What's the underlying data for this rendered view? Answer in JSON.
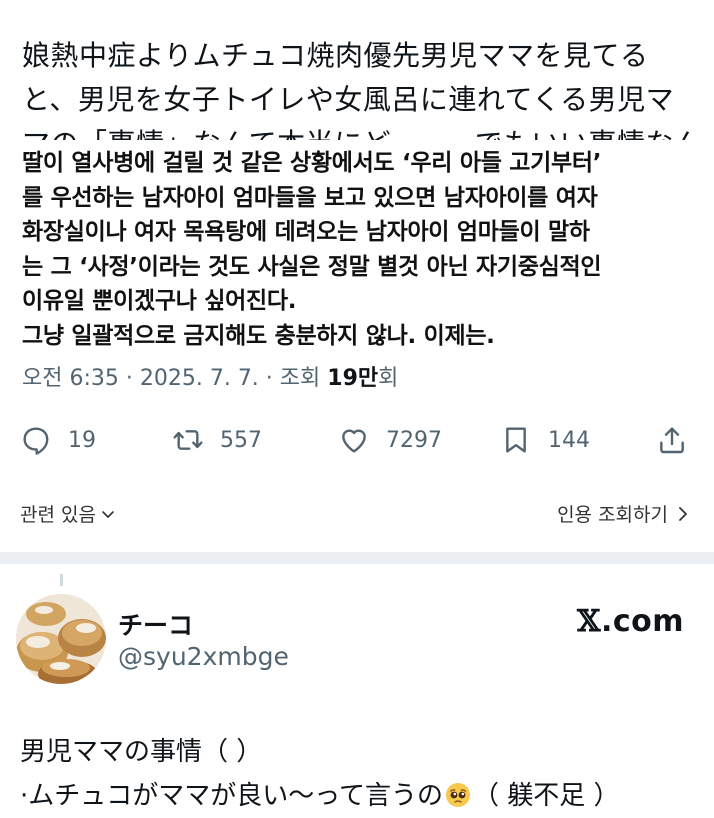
{
  "tweet": {
    "jp_lines": [
      "娘熱中症よりムチュコ焼肉優先男児ママを見てる",
      "と、男児を女子トイレや女風呂に連れてくる男児マ",
      "マの「事情」なんて本当にどーーーでもいい事情なんだ"
    ],
    "kr_lines": [
      "딸이 열사병에 걸릴 것 같은 상황에서도 ‘우리 아들 고기부터’",
      "를 우선하는 남자아이 엄마들을 보고 있으면 남자아이를 여자",
      "화장실이나 여자 목욕탕에 데려오는 남자아이 엄마들이 말하",
      "는 그 ‘사정’이라는 것도 사실은 정말 별것 아닌 자기중심적인",
      "이유일 뿐이겠구나 싶어진다.",
      "그냥 일괄적으로 금지해도 충분하지 않나. 이제는."
    ],
    "meta": {
      "time_date": "오전 6:35 · 2025. 7. 7. · 조회 ",
      "views_number": "19만",
      "views_suffix": "회"
    },
    "actions": {
      "replies": "19",
      "retweets": "557",
      "likes": "7297",
      "bookmarks": "144"
    },
    "related_label": "관련 있음",
    "quotes_label": "인용 조회하기"
  },
  "reply": {
    "display_name": "チーコ",
    "handle": "@syu2xmbge",
    "source_domain": ".com",
    "source_x": "𝕏",
    "line1": "男児ママの事情（ ）",
    "line2_before": "·ムチュコがママが良い～って言うの",
    "line2_after": "（ 躾不足 ）"
  },
  "colors": {
    "text": "#0f1419",
    "secondary": "#536471",
    "divider": "#eceff1"
  },
  "icons": [
    "reply-icon",
    "retweet-icon",
    "like-icon",
    "bookmark-icon",
    "share-icon",
    "chevron-down-icon",
    "chevron-right-icon",
    "pleading-face-emoji"
  ]
}
